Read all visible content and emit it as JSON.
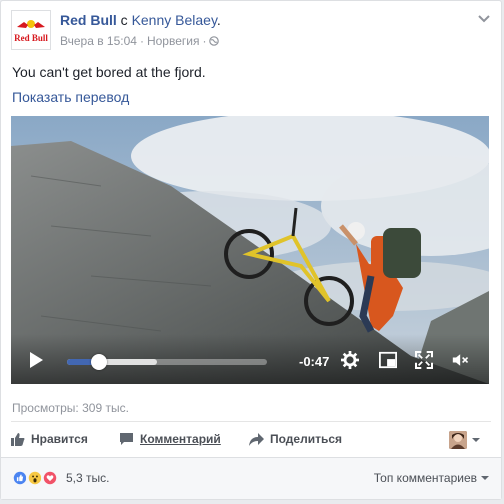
{
  "post": {
    "page_name": "Red Bull",
    "with_word": "с",
    "tagged_person": "Kenny Belaey",
    "period": ".",
    "time": "Вчера в 15:04",
    "separator": "·",
    "location": "Норвегия",
    "text": "You can't get bored at the fjord.",
    "translate_label": "Показать перевод"
  },
  "avatar_logo": {
    "text": "Red Bull",
    "icon": "red-bull-logo"
  },
  "video": {
    "elapsed_time": "-0:47",
    "progress_fraction": 0.16,
    "buffer_fraction": 0.45,
    "icons": [
      "play-icon",
      "gear-icon",
      "picture-in-picture-icon",
      "fullscreen-icon",
      "mute-icon"
    ]
  },
  "stats": {
    "views": "Просмотры: 309 тыс."
  },
  "actions": {
    "like_label": "Нравится",
    "comment_label": "Комментарий",
    "share_label": "Поделиться"
  },
  "footer": {
    "reaction_count": "5,3 тыс.",
    "top_comments_label": "Топ комментариев"
  },
  "colors": {
    "link": "#365899",
    "accent": "#4267b2",
    "muted": "#90949c"
  }
}
